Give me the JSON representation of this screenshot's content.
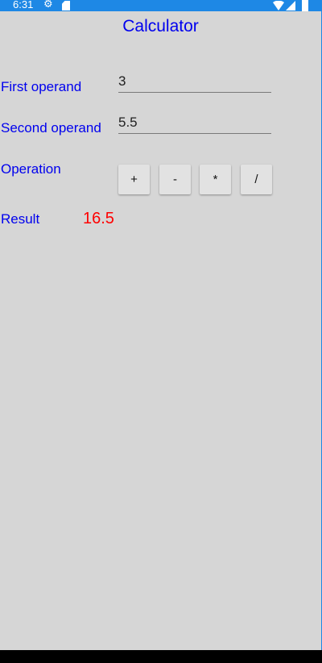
{
  "status_bar": {
    "time": "6:31",
    "icons": [
      "gear-icon",
      "sd-card-icon",
      "wifi-icon",
      "signal-icon",
      "battery-icon"
    ],
    "color": "#1e88e5"
  },
  "app": {
    "title": "Calculator",
    "title_color": "#0000ee",
    "background_color": "#d6d6d6"
  },
  "form": {
    "first_operand": {
      "label": "First operand",
      "value": "3"
    },
    "second_operand": {
      "label": "Second operand",
      "value": "5.5"
    },
    "operation": {
      "label": "Operation",
      "buttons": [
        "+",
        "-",
        "*",
        "/"
      ]
    },
    "result": {
      "label": "Result",
      "value": "16.5",
      "color": "#ff0000"
    }
  }
}
